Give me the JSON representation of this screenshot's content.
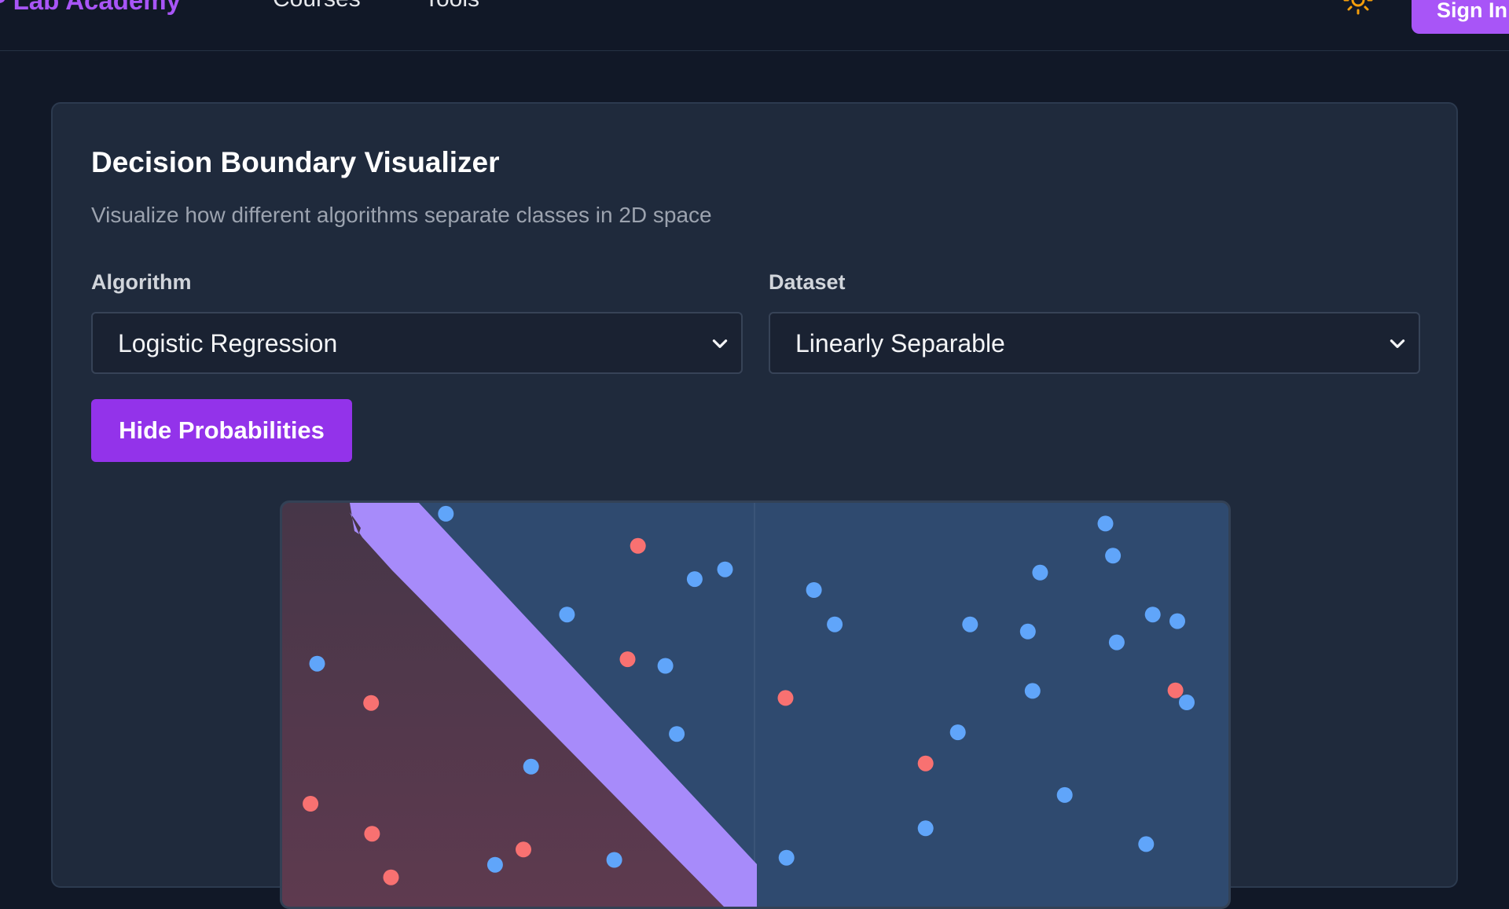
{
  "header": {
    "brand": "P Lab Academy",
    "nav": [
      "Courses",
      "Tools"
    ],
    "theme_icon": "sun-icon",
    "signin_label": "Sign In",
    "accent": "#a855f7"
  },
  "visualizer": {
    "title": "Decision Boundary Visualizer",
    "subtitle": "Visualize how different algorithms separate classes in 2D space",
    "algorithm_label": "Algorithm",
    "algorithm_value": "Logistic Regression",
    "dataset_label": "Dataset",
    "dataset_value": "Linearly Separable",
    "toggle_label": "Hide Probabilities",
    "button_color": "#9333ea"
  },
  "plot": {
    "class_colors": {
      "red": "#f87171",
      "blue": "#60a5fa"
    },
    "region_colors": {
      "red": "#5a3a50",
      "blue": "#2f4a6f",
      "boundary": "#a78bfa"
    },
    "points": [
      {
        "c": "blue",
        "x": 0.173,
        "y": 0.02
      },
      {
        "c": "red",
        "x": 0.376,
        "y": 0.079
      },
      {
        "c": "blue",
        "x": 0.436,
        "y": 0.14
      },
      {
        "c": "blue",
        "x": 0.468,
        "y": 0.122
      },
      {
        "c": "blue",
        "x": 0.301,
        "y": 0.205
      },
      {
        "c": "red",
        "x": 0.365,
        "y": 0.287
      },
      {
        "c": "blue",
        "x": 0.405,
        "y": 0.299
      },
      {
        "c": "blue",
        "x": 0.037,
        "y": 0.295
      },
      {
        "c": "red",
        "x": 0.094,
        "y": 0.367
      },
      {
        "c": "blue",
        "x": 0.417,
        "y": 0.424
      },
      {
        "c": "blue",
        "x": 0.263,
        "y": 0.484
      },
      {
        "c": "red",
        "x": 0.03,
        "y": 0.552
      },
      {
        "c": "red",
        "x": 0.095,
        "y": 0.607
      },
      {
        "c": "red",
        "x": 0.255,
        "y": 0.636
      },
      {
        "c": "blue",
        "x": 0.225,
        "y": 0.664
      },
      {
        "c": "red",
        "x": 0.115,
        "y": 0.687
      },
      {
        "c": "blue",
        "x": 0.351,
        "y": 0.655
      },
      {
        "c": "blue",
        "x": 0.562,
        "y": 0.16
      },
      {
        "c": "blue",
        "x": 0.584,
        "y": 0.223
      },
      {
        "c": "red",
        "x": 0.532,
        "y": 0.358
      },
      {
        "c": "blue",
        "x": 0.727,
        "y": 0.223
      },
      {
        "c": "blue",
        "x": 0.801,
        "y": 0.128
      },
      {
        "c": "blue",
        "x": 0.788,
        "y": 0.236
      },
      {
        "c": "blue",
        "x": 0.87,
        "y": 0.038
      },
      {
        "c": "blue",
        "x": 0.878,
        "y": 0.097
      },
      {
        "c": "blue",
        "x": 0.882,
        "y": 0.256
      },
      {
        "c": "blue",
        "x": 0.92,
        "y": 0.205
      },
      {
        "c": "blue",
        "x": 0.946,
        "y": 0.217
      },
      {
        "c": "blue",
        "x": 0.793,
        "y": 0.345
      },
      {
        "c": "red",
        "x": 0.944,
        "y": 0.344
      },
      {
        "c": "blue",
        "x": 0.956,
        "y": 0.366
      },
      {
        "c": "blue",
        "x": 0.714,
        "y": 0.421
      },
      {
        "c": "red",
        "x": 0.68,
        "y": 0.478
      },
      {
        "c": "blue",
        "x": 0.827,
        "y": 0.536
      },
      {
        "c": "blue",
        "x": 0.68,
        "y": 0.597
      },
      {
        "c": "blue",
        "x": 0.913,
        "y": 0.626
      },
      {
        "c": "blue",
        "x": 0.533,
        "y": 0.651
      }
    ]
  }
}
